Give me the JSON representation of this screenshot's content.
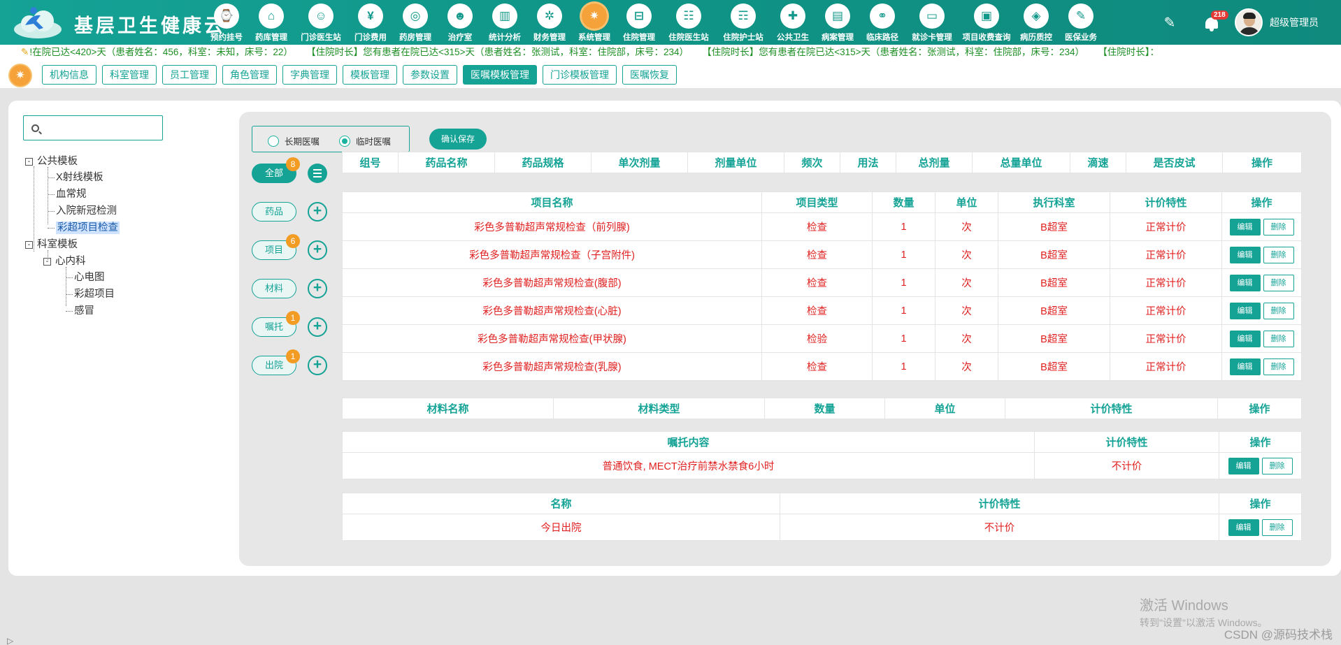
{
  "app": {
    "title": "基层卫生健康云",
    "user_name": "超级管理员",
    "notification_count": "218",
    "brand_color": "#15a396",
    "accent_color": "#f5a23a"
  },
  "nav": [
    {
      "label": "预约挂号",
      "icon": "calendar-icon",
      "glyph": "⌚"
    },
    {
      "label": "药库管理",
      "icon": "warehouse-icon",
      "glyph": "⌂"
    },
    {
      "label": "门诊医生站",
      "icon": "doctor-icon",
      "glyph": "☺"
    },
    {
      "label": "门诊费用",
      "icon": "yen-icon",
      "glyph": "¥"
    },
    {
      "label": "药房管理",
      "icon": "pill-icon",
      "glyph": "◎"
    },
    {
      "label": "治疗室",
      "icon": "nurse-icon",
      "glyph": "☻"
    },
    {
      "label": "统计分析",
      "icon": "chart-icon",
      "glyph": "▥"
    },
    {
      "label": "财务管理",
      "icon": "finance-gear-icon",
      "glyph": "✲"
    },
    {
      "label": "系统管理",
      "icon": "settings-gear-icon",
      "glyph": "✷",
      "active": true
    },
    {
      "label": "住院管理",
      "icon": "bed-icon",
      "glyph": "⊟"
    },
    {
      "label": "住院医生站",
      "icon": "ward-doctor-icon",
      "glyph": "☷"
    },
    {
      "label": "住院护士站",
      "icon": "ward-nurse-icon",
      "glyph": "☶"
    },
    {
      "label": "公共卫生",
      "icon": "public-health-icon",
      "glyph": "✚"
    },
    {
      "label": "病案管理",
      "icon": "case-record-icon",
      "glyph": "▤"
    },
    {
      "label": "临床路径",
      "icon": "pathway-icon",
      "glyph": "⚭"
    },
    {
      "label": "就诊卡管理",
      "icon": "card-icon",
      "glyph": "▭"
    },
    {
      "label": "项目收费查询",
      "icon": "fee-query-icon",
      "glyph": "▣"
    },
    {
      "label": "病历质控",
      "icon": "quality-control-icon",
      "glyph": "◈"
    },
    {
      "label": "医保业务",
      "icon": "insurance-icon",
      "glyph": "✎"
    }
  ],
  "marquee": [
    "!在院已达<420>天（患者姓名：456，科室：未知，床号：22）",
    "【住院时长】您有患者在院已达<315>天（患者姓名：张测试，科室：住院部，床号：234）",
    "【住院时长】您有患者在院已达<315>天（患者姓名：张测试，科室：住院部，床号：234）",
    "【住院时长】："
  ],
  "tabs": [
    {
      "label": "机构信息"
    },
    {
      "label": "科室管理"
    },
    {
      "label": "员工管理"
    },
    {
      "label": "角色管理"
    },
    {
      "label": "字典管理"
    },
    {
      "label": "模板管理"
    },
    {
      "label": "参数设置"
    },
    {
      "label": "医嘱模板管理",
      "active": true
    },
    {
      "label": "门诊模板管理"
    },
    {
      "label": "医嘱恢复"
    }
  ],
  "search": {
    "placeholder": "",
    "value": ""
  },
  "tree": {
    "public": {
      "label": "公共模板",
      "toggle": "-"
    },
    "public_children": [
      "X射线模板",
      "血常规",
      "入院新冠检测",
      "彩超项目检查"
    ],
    "dept": {
      "label": "科室模板",
      "toggle": "-"
    },
    "cardio": {
      "label": "心内科",
      "toggle": "-"
    },
    "cardio_children": [
      "心电图",
      "彩超项目",
      "感冒"
    ]
  },
  "order_type": {
    "long_term": "长期医嘱",
    "temporary": "临时医嘱",
    "selected": "临时医嘱",
    "save_label": "确认保存"
  },
  "categories": [
    {
      "label": "全部",
      "badge": "8"
    },
    {
      "label": "药品",
      "badge": ""
    },
    {
      "label": "项目",
      "badge": "6"
    },
    {
      "label": "材料",
      "badge": ""
    },
    {
      "label": "嘱托",
      "badge": "1"
    },
    {
      "label": "出院",
      "badge": "1"
    }
  ],
  "drug_table": {
    "headers": [
      "组号",
      "药品名称",
      "药品规格",
      "单次剂量",
      "剂量单位",
      "频次",
      "用法",
      "总剂量",
      "总量单位",
      "滴速",
      "是否皮试",
      "操作"
    ]
  },
  "item_table": {
    "headers": [
      "项目名称",
      "项目类型",
      "数量",
      "单位",
      "执行科室",
      "计价特性",
      "操作"
    ],
    "rows": [
      [
        "彩色多普勒超声常规检查（前列腺)",
        "检查",
        "1",
        "次",
        "B超室",
        "正常计价"
      ],
      [
        "彩色多普勒超声常规检查（子宫附件)",
        "检查",
        "1",
        "次",
        "B超室",
        "正常计价"
      ],
      [
        "彩色多普勒超声常规检查(腹部)",
        "检查",
        "1",
        "次",
        "B超室",
        "正常计价"
      ],
      [
        "彩色多普勒超声常规检查(心脏)",
        "检查",
        "1",
        "次",
        "B超室",
        "正常计价"
      ],
      [
        "彩色多普勒超声常规检查(甲状腺)",
        "检验",
        "1",
        "次",
        "B超室",
        "正常计价"
      ],
      [
        "彩色多普勒超声常规检查(乳腺)",
        "检查",
        "1",
        "次",
        "B超室",
        "正常计价"
      ]
    ]
  },
  "material_table": {
    "headers": [
      "材料名称",
      "材料类型",
      "数量",
      "单位",
      "计价特性",
      "操作"
    ]
  },
  "entrust_table": {
    "headers": [
      "嘱托内容",
      "计价特性",
      "操作"
    ],
    "rows": [
      [
        "普通饮食, MECT治疗前禁水禁食6小时",
        "不计价"
      ]
    ]
  },
  "discharge_table": {
    "headers": [
      "名称",
      "计价特性",
      "操作"
    ],
    "rows": [
      [
        "今日出院",
        "不计价"
      ]
    ]
  },
  "actions": {
    "edit": "编辑",
    "delete": "删除"
  },
  "watermark": {
    "line1": "激活 Windows",
    "line2": "转到\"设置\"以激活 Windows。"
  },
  "csdn": "CSDN @源码技术栈",
  "corner_glyph": "▷"
}
